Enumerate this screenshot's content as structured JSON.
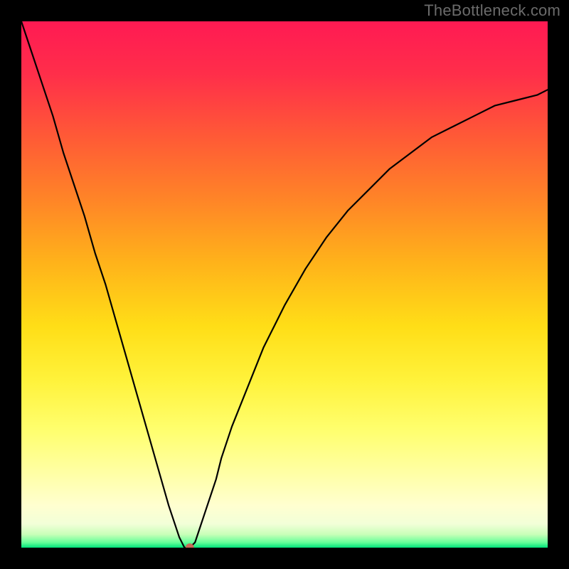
{
  "watermark": "TheBottleneck.com",
  "colors": {
    "background": "#000000",
    "curve": "#000000",
    "marker": "#c96a57",
    "watermark_text": "#6b6b6b",
    "gradient_stops": [
      {
        "offset": 0.0,
        "color": "#ff1a53"
      },
      {
        "offset": 0.1,
        "color": "#ff2e4a"
      },
      {
        "offset": 0.22,
        "color": "#ff5a36"
      },
      {
        "offset": 0.34,
        "color": "#ff8527"
      },
      {
        "offset": 0.46,
        "color": "#ffb31a"
      },
      {
        "offset": 0.58,
        "color": "#ffde17"
      },
      {
        "offset": 0.68,
        "color": "#fff23a"
      },
      {
        "offset": 0.78,
        "color": "#ffff70"
      },
      {
        "offset": 0.86,
        "color": "#ffffa6"
      },
      {
        "offset": 0.92,
        "color": "#ffffd0"
      },
      {
        "offset": 0.955,
        "color": "#f2ffd8"
      },
      {
        "offset": 0.975,
        "color": "#c8ffb8"
      },
      {
        "offset": 0.99,
        "color": "#66ff99"
      },
      {
        "offset": 1.0,
        "color": "#00e27a"
      }
    ]
  },
  "chart_data": {
    "type": "line",
    "title": "",
    "xlabel": "",
    "ylabel": "",
    "xlim": [
      0,
      100
    ],
    "ylim": [
      0,
      100
    ],
    "grid": false,
    "legend": false,
    "x": [
      0,
      2,
      4,
      6,
      8,
      10,
      12,
      14,
      16,
      18,
      20,
      22,
      24,
      26,
      28,
      30,
      31,
      32,
      33,
      34,
      35,
      36,
      37,
      38,
      40,
      42,
      44,
      46,
      48,
      50,
      54,
      58,
      62,
      66,
      70,
      74,
      78,
      82,
      86,
      90,
      94,
      98,
      100
    ],
    "series": [
      {
        "name": "bottleneck-curve",
        "values": [
          100,
          94,
          88,
          82,
          75,
          69,
          63,
          56,
          50,
          43,
          36,
          29,
          22,
          15,
          8,
          2,
          0,
          0,
          1,
          4,
          7,
          10,
          13,
          17,
          23,
          28,
          33,
          38,
          42,
          46,
          53,
          59,
          64,
          68,
          72,
          75,
          78,
          80,
          82,
          84,
          85,
          86,
          87
        ]
      }
    ],
    "marker": {
      "x": 32,
      "y": 0
    }
  }
}
